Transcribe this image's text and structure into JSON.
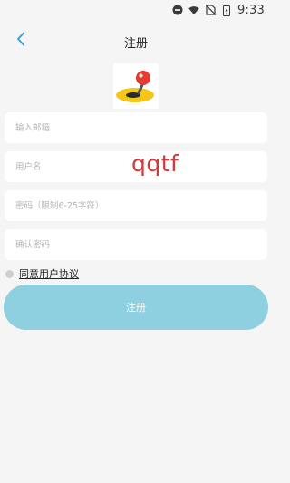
{
  "status_bar": {
    "time": "9:33",
    "icons": [
      "do-not-disturb-icon",
      "wifi-icon",
      "no-sim-icon",
      "battery-icon"
    ]
  },
  "header": {
    "title": "注册",
    "back_icon": "chevron-left-icon"
  },
  "logo": {
    "icon": "app-logo"
  },
  "form": {
    "email_placeholder": "输入邮箱",
    "username_placeholder": "用户名",
    "password_placeholder": "密码（限制6-25字符）",
    "confirm_placeholder": "确认密码"
  },
  "watermark": "qqtf",
  "agreement": {
    "label": "同意用户协议"
  },
  "submit": {
    "label": "注册"
  },
  "colors": {
    "accent": "#3fa0d8",
    "button": "#8ecfe0",
    "background": "#f5f5f5",
    "watermark": "#d23a3a"
  }
}
